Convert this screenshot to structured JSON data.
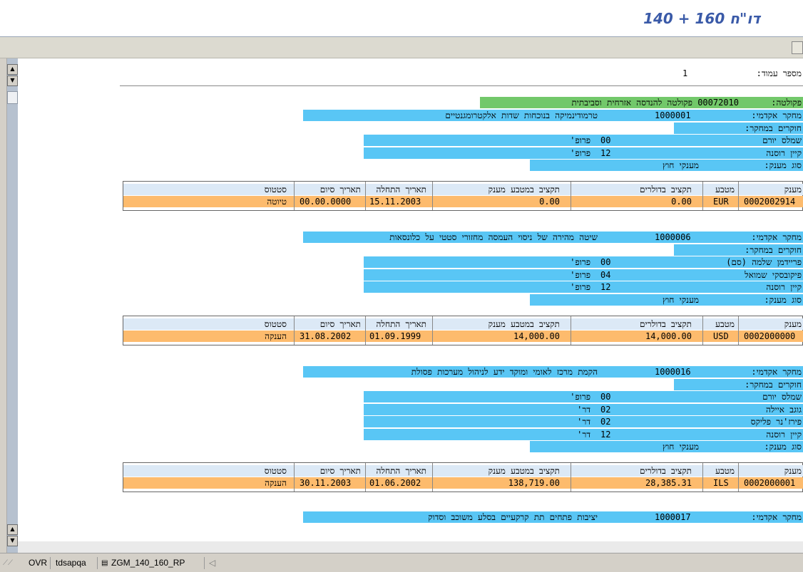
{
  "window": {
    "title": "דו\"ח 160 + 140"
  },
  "page": {
    "label": "מספר עמוד:",
    "number": "1"
  },
  "faculty": {
    "label": "פקולטה:",
    "value": "00072010 פקולטה להנדסה אזרחית וסביבתית"
  },
  "grant_table": {
    "headers": [
      "מענק",
      "מטבע",
      "תקציב בדולרים",
      "תקציב במטבע מענק",
      "תאריך התחלה",
      "תאריך סיום",
      "סטטוס"
    ]
  },
  "labels": {
    "researcher_role": "פרופ'",
    "researcher_role_dr": "דר'",
    "research_no": "מחקר אקדמי:",
    "partners": "חוקרים במחקר:",
    "grantor_type": "סוג מענק:"
  },
  "projects": [
    {
      "number": "1000001",
      "title": "טרמודינמיקה בנוכחות שדות אלקטרומגנטיים",
      "researchers": [
        {
          "name": "שמלס יורם",
          "code": "00",
          "role": "פרופ'"
        },
        {
          "name": "קיין רוסנה",
          "code": "12",
          "role": "פרופ'"
        }
      ],
      "grantor_type": "מענקי חוץ",
      "grant": {
        "id": "0002002914",
        "currency": "EUR",
        "usd": "0.00",
        "amount": "0.00",
        "start": "15.11.2003",
        "end": "00.00.0000",
        "status": "טיוטה"
      }
    },
    {
      "number": "1000006",
      "title": "שיטה מהירה של ניסוי העמסה מחזורי סטטי על כלונסאות",
      "researchers": [
        {
          "name": "פריידמן שלמה (סם)",
          "code": "00",
          "role": "פרופ'"
        },
        {
          "name": "פיקובסקי שמואל",
          "code": "04",
          "role": "פרופ'"
        },
        {
          "name": "קיין רוסנה",
          "code": "12",
          "role": "פרופ'"
        }
      ],
      "grantor_type": "מענקי חוץ",
      "grant": {
        "id": "0002000000",
        "currency": "USD",
        "usd": "14,000.00",
        "amount": "14,000.00",
        "start": "01.09.1999",
        "end": "31.08.2002",
        "status": "הענקה"
      }
    },
    {
      "number": "1000016",
      "title": "הקמת מרכז לאומי ומוקד ידע לניהול מערכות פסולת",
      "researchers": [
        {
          "name": "שמלס יורם",
          "code": "00",
          "role": "פרופ'"
        },
        {
          "name": "גוגב איילה",
          "code": "02",
          "role": "דר'"
        },
        {
          "name": "פירז'נר פליקס",
          "code": "02",
          "role": "דר'"
        },
        {
          "name": "קיין רוסנה",
          "code": "12",
          "role": "דר'"
        }
      ],
      "grantor_type": "מענקי חוץ",
      "grant": {
        "id": "0002000001",
        "currency": "ILS",
        "usd": "28,385.31",
        "amount": "138,719.00",
        "start": "01.06.2002",
        "end": "30.11.2003",
        "status": "הענקה"
      }
    },
    {
      "number": "1000017",
      "title": "יציבות פתחים תת קרקעיים בסלע משוכב וסדוק"
    }
  ],
  "statusbar": {
    "mode": "OVR",
    "server": "tdsapqa",
    "program": "ZGM_140_160_RP"
  },
  "colors": {
    "blue": "#59c6f5",
    "green": "#72c86a",
    "orange": "#fdbb6d",
    "header": "#dce9f6",
    "title": "#3a5aa8"
  }
}
